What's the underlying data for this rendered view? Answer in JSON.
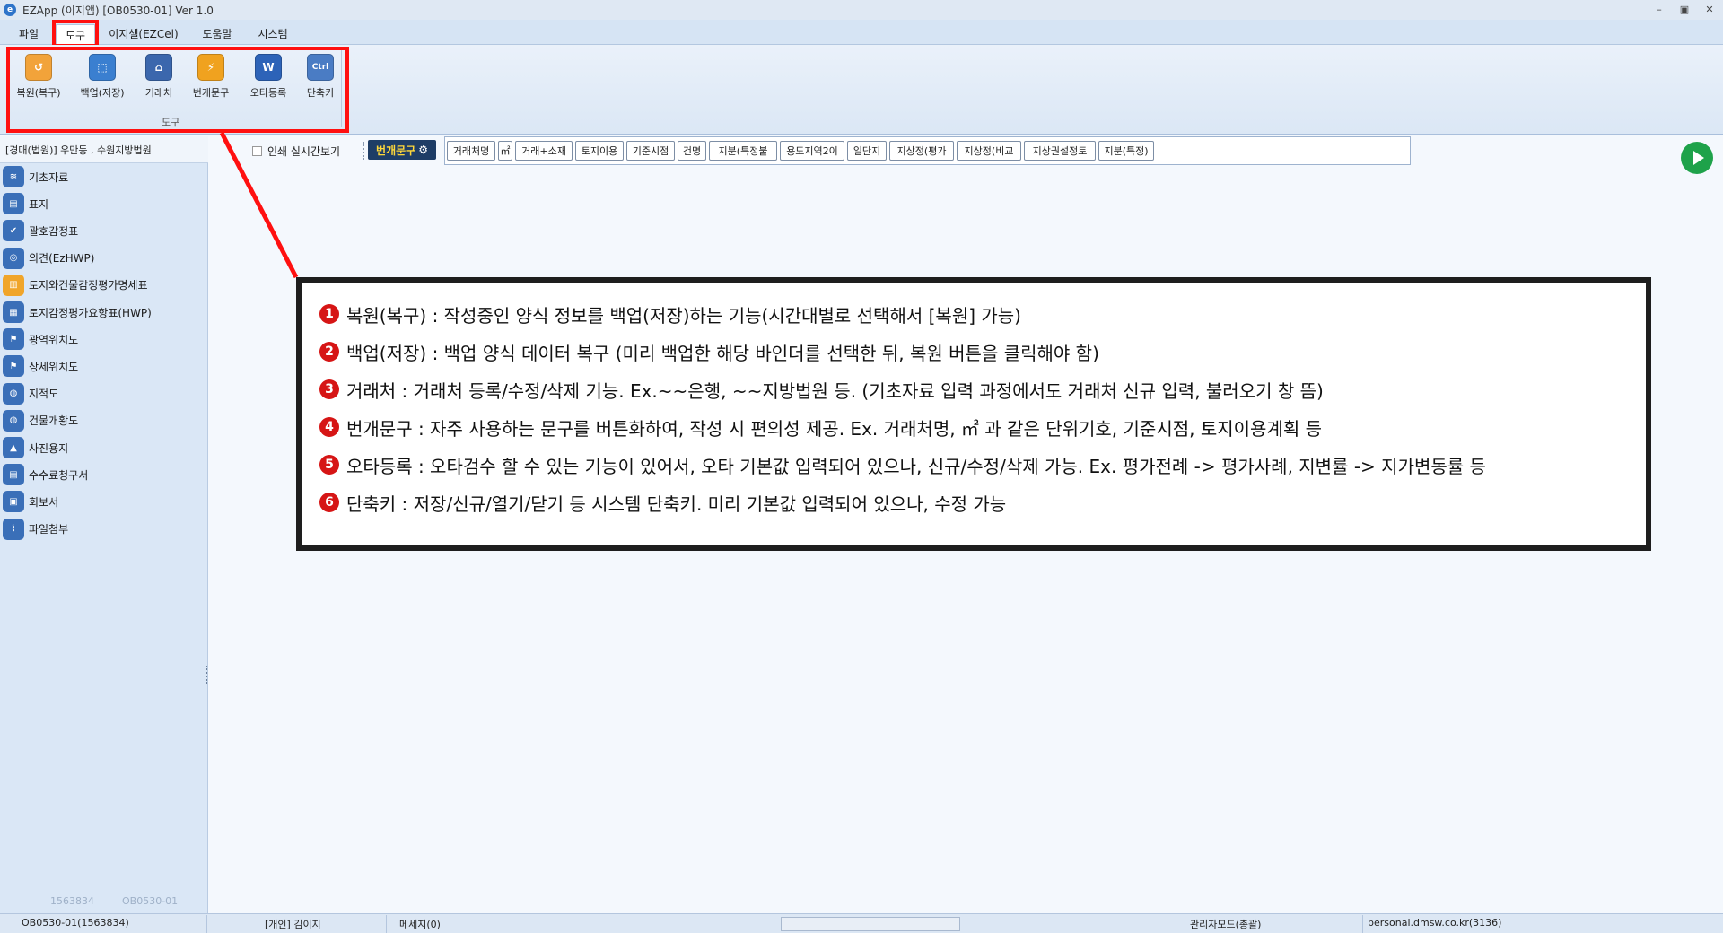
{
  "window": {
    "title": "EZApp (이지앱) [OB0530-01] Ver 1.0",
    "controls": [
      "–",
      "▣",
      "✕"
    ]
  },
  "menu": {
    "items": [
      "파일",
      "도구",
      "이지셀(EZCel)",
      "도움말",
      "시스템"
    ],
    "active": "도구"
  },
  "ribbon": {
    "group_label": "도구",
    "tools": [
      {
        "label": "복원(복구)",
        "icon": "folder-restore-icon",
        "color": "#f2a33a"
      },
      {
        "label": "백업(저장)",
        "icon": "backup-save-icon",
        "color": "#3a7fd0"
      },
      {
        "label": "거래처",
        "icon": "client-building-icon",
        "color": "#3b67ad"
      },
      {
        "label": "번개문구",
        "icon": "lightning-phrase-icon",
        "color": "#f0a21f"
      },
      {
        "label": "오타등록",
        "icon": "word-typo-icon",
        "color": "#2d63b8"
      },
      {
        "label": "단축키",
        "icon": "ctrl-shortcut-icon",
        "color": "#4a7cc4"
      }
    ]
  },
  "left_panel": {
    "header": "[경매(법원)] 우만동 , 수원지방법원",
    "items": [
      {
        "label": "기초자료",
        "icon": "stack-layers-icon",
        "color": "#3a6fb8"
      },
      {
        "label": "표지",
        "icon": "cover-page-icon",
        "color": "#3a6fb8"
      },
      {
        "label": "괄호감정표",
        "icon": "appraisal-check-icon",
        "color": "#3a6fb8"
      },
      {
        "label": "의견(EzHWP)",
        "icon": "opinion-doc-icon",
        "color": "#3a6fb8"
      },
      {
        "label": "토지와건물감정평가명세표",
        "icon": "map-book-icon",
        "color": "#f0a52a"
      },
      {
        "label": "토지감정평가요항표(HWP)",
        "icon": "map-sheet-icon",
        "color": "#3a6fb8"
      },
      {
        "label": "광역위치도",
        "icon": "location-pin-icon",
        "color": "#3a6fb8"
      },
      {
        "label": "상세위치도",
        "icon": "detail-pin-icon",
        "color": "#3a6fb8"
      },
      {
        "label": "지적도",
        "icon": "globe-map-icon",
        "color": "#3a6fb8"
      },
      {
        "label": "건물개황도",
        "icon": "building-globe-icon",
        "color": "#3a6fb8"
      },
      {
        "label": "사진용지",
        "icon": "photo-icon",
        "color": "#3a6fb8"
      },
      {
        "label": "수수료청구서",
        "icon": "invoice-icon",
        "color": "#3a6fb8"
      },
      {
        "label": "회보서",
        "icon": "clipboard-icon",
        "color": "#3a6fb8"
      },
      {
        "label": "파일첨부",
        "icon": "paperclip-icon",
        "color": "#3a6fb8"
      }
    ],
    "footer_left": "1563834",
    "footer_right": "OB0530-01"
  },
  "content": {
    "print_preview_label": "인쇄 실시간보기",
    "beongae_label": "번개문구",
    "phrases": [
      "거래처명",
      "㎡",
      "거래+소재",
      "토지이용",
      "기준시점",
      "건명",
      "지분(특정불",
      "용도지역2이",
      "일단지",
      "지상정(평가",
      "지상정(비교",
      "지상권설정토",
      "지분(특정)"
    ]
  },
  "annotation": {
    "accent": "#ff1010",
    "lines": [
      {
        "num": "1",
        "text": "복원(복구) : 작성중인 양식 정보를 백업(저장)하는 기능(시간대별로 선택해서 [복원] 가능)"
      },
      {
        "num": "2",
        "text": "백업(저장) : 백업 양식 데이터 복구 (미리 백업한 해당 바인더를 선택한 뒤, 복원 버튼을 클릭해야 함)"
      },
      {
        "num": "3",
        "text": "거래처 : 거래처 등록/수정/삭제 기능. Ex.~~은행, ~~지방법원 등. (기초자료 입력 과정에서도 거래처 신규 입력, 불러오기 창 뜸)"
      },
      {
        "num": "4",
        "text": "번개문구 : 자주 사용하는 문구를 버튼화하여, 작성 시 편의성 제공. Ex. 거래처명, ㎡ 과 같은 단위기호, 기준시점, 토지이용계획 등"
      },
      {
        "num": "5",
        "text": "오타등록 : 오타검수 할 수 있는 기능이 있어서, 오타 기본값 입력되어 있으나, 신규/수정/삭제 가능. Ex. 평가전례 -> 평가사례, 지변률 -> 지가변동률 등"
      },
      {
        "num": "6",
        "text": "단축키 : 저장/신규/열기/닫기 등 시스템 단축키. 미리 기본값 입력되어 있으나, 수정 가능"
      }
    ]
  },
  "status_bar": {
    "code": "OB0530-01(1563834)",
    "user": "[개인] 김이지",
    "message": "메세지(0)",
    "mode": "관리자모드(총괄)",
    "server": "personal.dmsw.co.kr(3136)"
  }
}
